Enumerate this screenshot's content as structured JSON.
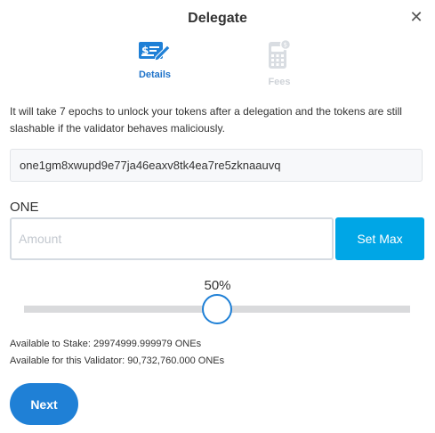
{
  "dialog": {
    "title": "Delegate",
    "close_icon": "close-icon"
  },
  "steps": [
    {
      "label": "Details",
      "icon": "check-pen-icon",
      "active": true
    },
    {
      "label": "Fees",
      "icon": "calculator-icon",
      "active": false
    }
  ],
  "info_text": "It will take 7 epochs to unlock your tokens after a delegation and the tokens are still slashable if the validator behaves maliciously.",
  "validator_address": "one1gm8xwupd9e77ja46eaxv8tk4ea7re5zknaauvq",
  "amount": {
    "unit_label": "ONE",
    "placeholder": "Amount",
    "value": "",
    "set_max_label": "Set Max"
  },
  "slider": {
    "percent_label": "50%",
    "value": 0.5
  },
  "available_to_stake": "Available to Stake: 29974999.999979 ONEs",
  "available_for_validator": "Available for this Validator: 90,732,760.000 ONEs",
  "next_label": "Next",
  "colors": {
    "accent": "#1f80d6",
    "set_max": "#00a6e6",
    "inactive_step": "#cfd3d8"
  }
}
